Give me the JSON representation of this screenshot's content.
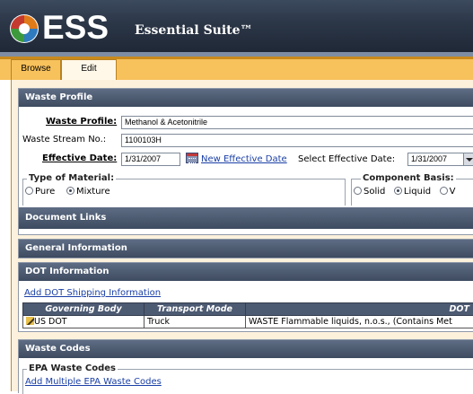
{
  "app": {
    "logo_text": "ESS",
    "subtitle": "Essential Suite™"
  },
  "tabs": [
    {
      "label": "Browse",
      "active": false
    },
    {
      "label": "Edit",
      "active": true
    }
  ],
  "waste_profile_panel": {
    "title": "Waste Profile",
    "waste_profile_label": "Waste Profile:",
    "waste_profile_value": "Methanol & Acetonitrile",
    "stream_no_label": "Waste Stream No.:",
    "stream_no_value": "1100103H",
    "effective_date_label": "Effective Date:",
    "effective_date_value": "1/31/2007",
    "new_effective_date_link": "New Effective Date",
    "select_effective_date_label": "Select Effective Date:",
    "select_effective_date_value": "1/31/2007",
    "material_type": {
      "legend": "Type of Material:",
      "options": [
        "Pure",
        "Mixture"
      ],
      "selected": "Mixture"
    },
    "component_basis": {
      "legend": "Component Basis:",
      "options": [
        "Solid",
        "Liquid",
        "V"
      ],
      "selected": "Liquid"
    },
    "document_links_label": "Document Links"
  },
  "general_info_panel": {
    "title": "General Information"
  },
  "dot_panel": {
    "title": "DOT Information",
    "add_link": "Add DOT Shipping Information",
    "columns": [
      "Governing Body",
      "Transport Mode",
      "DOT"
    ],
    "rows": [
      {
        "governing_body": "US DOT",
        "transport_mode": "Truck",
        "dot": "WASTE Flammable liquids, n.o.s., (Contains Met"
      }
    ]
  },
  "waste_codes_panel": {
    "title": "Waste Codes",
    "epa_legend": "EPA Waste Codes",
    "add_multiple_link": "Add Multiple EPA Waste Codes"
  },
  "colors": {
    "header_dark": "#2b3647",
    "tab_orange": "#f7c15c",
    "panel_header": "#4c5a72",
    "link_blue": "#1a3fa6"
  }
}
